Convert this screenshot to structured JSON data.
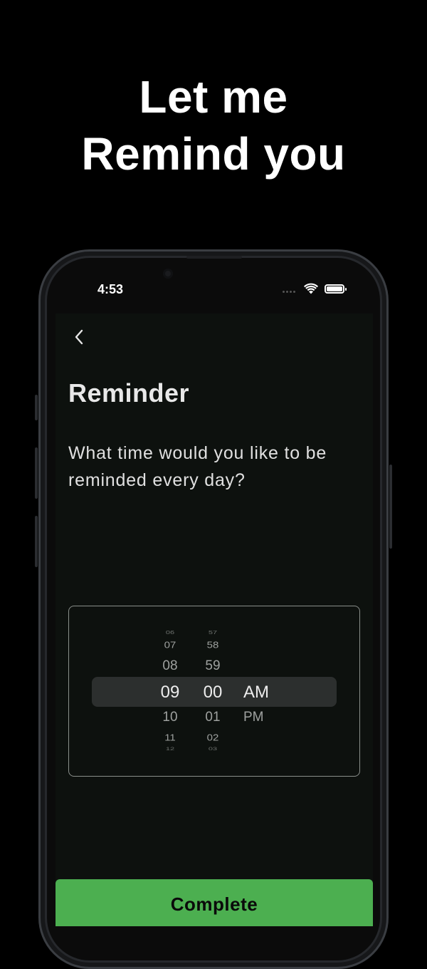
{
  "headline": {
    "line1": "Let me",
    "line2": "Remind you"
  },
  "status_bar": {
    "time": "4:53",
    "wifi_icon": "wifi-icon",
    "battery_icon": "battery-icon"
  },
  "screen": {
    "back_icon": "chevron-left-icon",
    "title": "Reminder",
    "question": "What time would you like to be reminded every day?",
    "picker": {
      "hours": {
        "above": [
          "06",
          "07",
          "08"
        ],
        "selected": "09",
        "below": [
          "10",
          "11",
          "12"
        ]
      },
      "minutes": {
        "above": [
          "57",
          "58",
          "59"
        ],
        "selected": "00",
        "below": [
          "01",
          "02",
          "03"
        ]
      },
      "period": {
        "selected": "AM",
        "below": [
          "PM"
        ]
      }
    },
    "complete_label": "Complete"
  },
  "colors": {
    "background": "#000000",
    "screen_bg": "#0d110e",
    "accent_green": "#4caf50",
    "text_primary": "#e8e8e8",
    "picker_dim": "#9ea19f"
  }
}
